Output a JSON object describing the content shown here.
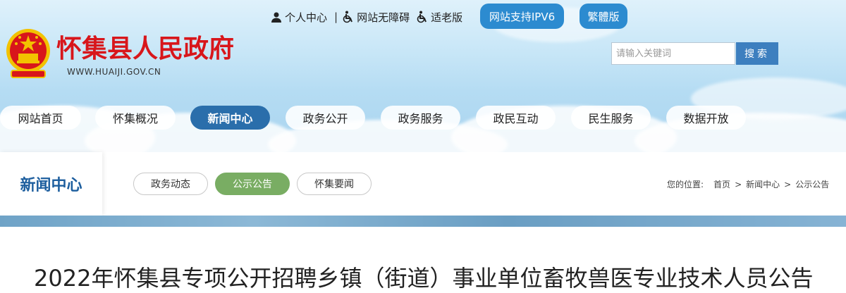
{
  "top_links": {
    "personal": "个人中心",
    "divider": "|",
    "accessible": "网站无障碍",
    "elderly": "适老版",
    "ipv6": "网站支持IPV6",
    "traditional": "繁體版"
  },
  "site": {
    "title": "怀集县人民政府",
    "url": "WWW.HUAIJI.GOV.CN"
  },
  "search": {
    "placeholder": "请输入关键词",
    "button": "搜索"
  },
  "nav": [
    "网站首页",
    "怀集概况",
    "新闻中心",
    "政务公开",
    "政务服务",
    "政民互动",
    "民生服务",
    "数据开放"
  ],
  "nav_active": "新闻中心",
  "section": {
    "title": "新闻中心",
    "tabs": [
      "政务动态",
      "公示公告",
      "怀集要闻"
    ],
    "active_tab": "公示公告"
  },
  "breadcrumb": {
    "label": "您的位置:",
    "items": [
      "首页",
      "新闻中心",
      "公示公告"
    ],
    "sep": ">"
  },
  "article": {
    "title": "2022年怀集县专项公开招聘乡镇（街道）事业单位畜牧兽医专业技术人员公告"
  },
  "colors": {
    "primary": "#2a6eab",
    "brand_red": "#d8161b",
    "tab_active": "#79ad63",
    "pill_blue": "#2c8bd0"
  }
}
